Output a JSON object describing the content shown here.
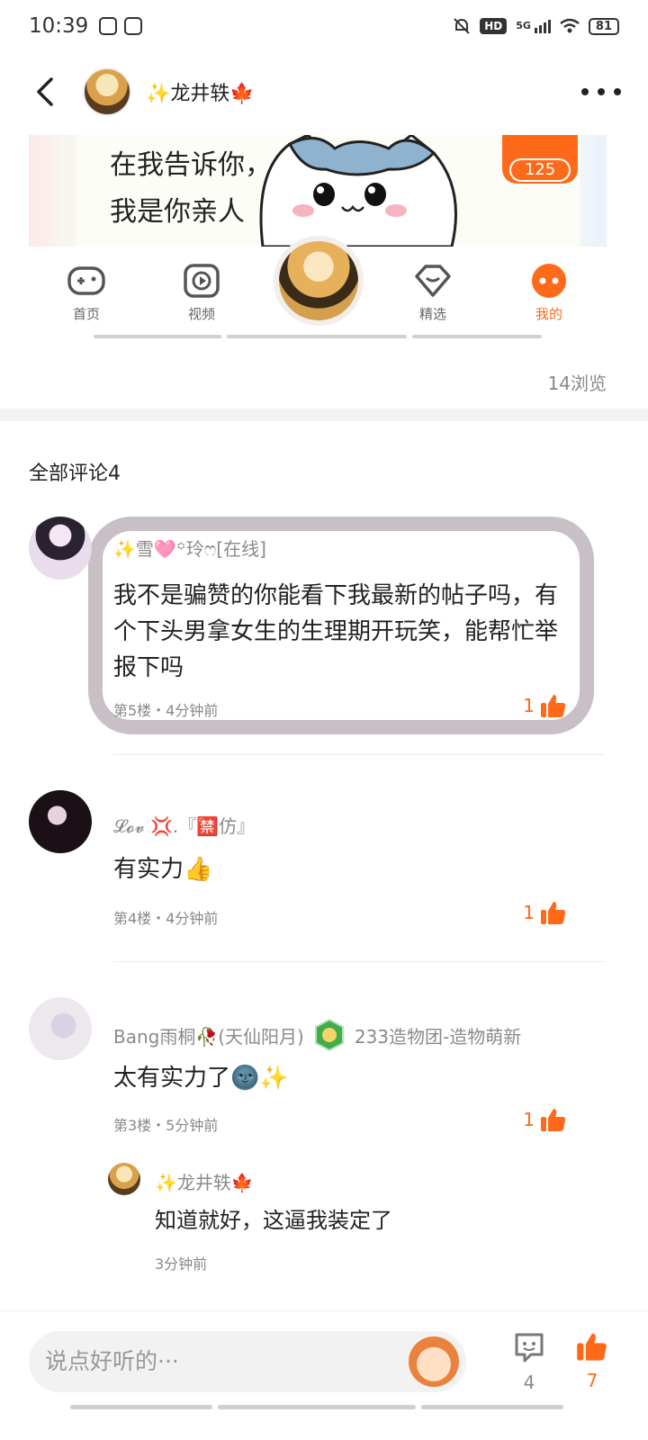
{
  "status_bar": {
    "time": "10:39",
    "hd": "HD",
    "network": "5G",
    "battery": "81"
  },
  "header": {
    "title": "✨龙井轶🍁"
  },
  "post": {
    "image_text": "在我告诉你，我是你亲人",
    "like_count": "125",
    "nav": [
      {
        "label": "首页",
        "icon": "gamepad-icon"
      },
      {
        "label": "视频",
        "icon": "play-icon"
      },
      {
        "label": "精选",
        "icon": "heart-icon"
      },
      {
        "label": "我的",
        "icon": "face-icon"
      }
    ],
    "views": "14浏览"
  },
  "comments_title": "全部评论4",
  "comments": [
    {
      "name": "✨雪🩷꙳玲ෆ[在线]",
      "text": "我不是骗赞的你能看下我最新的帖子吗，有个下头男拿女生的生理期开玩笑，能帮忙举报下吗",
      "meta": "第5楼・4分钟前",
      "likes": "1"
    },
    {
      "name": "𝓛𝓸𝓿 💢.『🈲仿』",
      "text": "有实力👍",
      "meta": "第4楼・4分钟前",
      "likes": "1"
    },
    {
      "name": "Bang雨桐🥀(天仙阳月)",
      "badge": "233造物团-造物萌新",
      "text": "太有实力了🌚✨",
      "meta": "第3楼・5分钟前",
      "likes": "1",
      "reply": {
        "name": "✨龙井轶🍁",
        "text": "知道就好，这逼我装定了",
        "time": "3分钟前"
      }
    }
  ],
  "bottom_bar": {
    "placeholder": "说点好听的···",
    "comment_count": "4",
    "like_count": "7"
  },
  "colors": {
    "accent": "#ff6a1a",
    "frame": "#c9bfc6"
  }
}
